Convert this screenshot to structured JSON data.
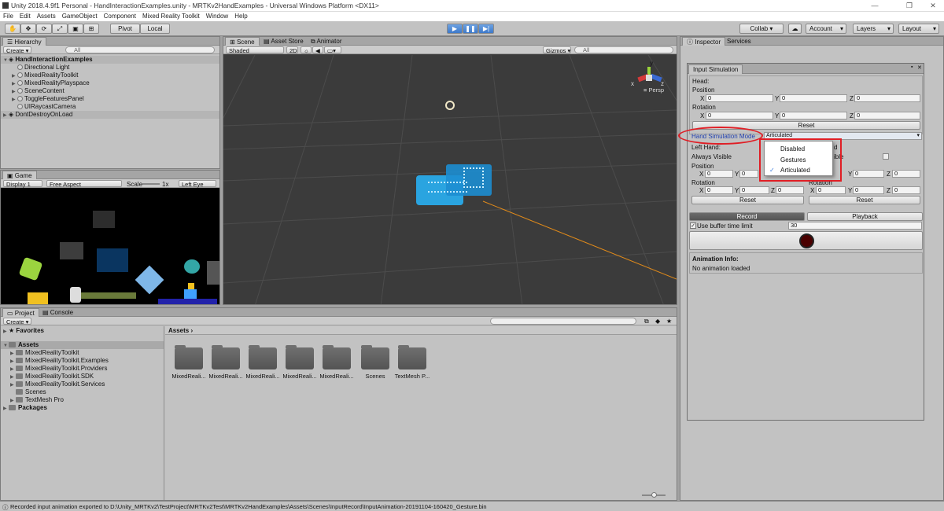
{
  "titlebar": {
    "title": "Unity 2018.4.9f1 Personal - HandInteractionExamples.unity - MRTKv2HandExamples - Universal Windows Platform <DX11>",
    "min": "—",
    "max": "❐",
    "close": "✕"
  },
  "menu": [
    "File",
    "Edit",
    "Assets",
    "GameObject",
    "Component",
    "Mixed Reality Toolkit",
    "Window",
    "Help"
  ],
  "toolbar": {
    "pivot": "Pivot",
    "local": "Local",
    "collab": "Collab ▾",
    "account": "Account",
    "layers": "Layers",
    "layout": "Layout"
  },
  "hierarchy": {
    "tab": "Hierarchy",
    "create": "Create",
    "search_placeholder": "All",
    "scene": "HandInteractionExamples",
    "items": [
      "Directional Light",
      "MixedRealityToolkit",
      "MixedRealityPlayspace",
      "SceneContent",
      "ToggleFeaturesPanel",
      "UIRaycastCamera"
    ],
    "dont_destroy": "DontDestroyOnLoad"
  },
  "game": {
    "tab": "Game",
    "display": "Display 1",
    "aspect": "Free Aspect",
    "scale_label": "Scale",
    "scale_value": "1x",
    "eye": "Left Eye"
  },
  "scene": {
    "tabs": [
      "Scene",
      "Asset Store",
      "Animator"
    ],
    "shaded": "Shaded",
    "mode2d": "2D",
    "gizmos": "Gizmos",
    "search_placeholder": "All",
    "persp": "Persp",
    "gizmo_x": "x",
    "gizmo_y": "y",
    "gizmo_z": "z"
  },
  "project": {
    "tabs": [
      "Project",
      "Console"
    ],
    "create": "Create",
    "favorites": "Favorites",
    "assets": "Assets",
    "tree": [
      "MixedRealityToolkit",
      "MixedRealityToolkit.Examples",
      "MixedRealityToolkit.Providers",
      "MixedRealityToolkit.SDK",
      "MixedRealityToolkit.Services",
      "Scenes",
      "TextMesh Pro"
    ],
    "packages": "Packages",
    "breadcrumb": "Assets",
    "breadcrumb_arrow": "›",
    "folders": [
      "MixedReali...",
      "MixedReali...",
      "MixedReali...",
      "MixedReali...",
      "MixedReali...",
      "Scenes",
      "TextMesh P..."
    ]
  },
  "inspector": {
    "tabs": [
      "Inspector",
      "Services"
    ],
    "window_title": "Input Simulation",
    "head": "Head:",
    "position": "Position",
    "rotation": "Rotation",
    "x": "X",
    "y": "Y",
    "z": "Z",
    "zero": "0",
    "reset": "Reset",
    "hand_mode_label": "Hand Simulation Mode",
    "hand_mode_value": "Articulated",
    "left_hand": "Left Hand:",
    "right_hand_fragment": "d",
    "always_visible": "Always Visible",
    "always_visible_fragment": "ible",
    "dropdown": [
      {
        "label": "Disabled",
        "checked": false
      },
      {
        "label": "Gestures",
        "checked": false
      },
      {
        "label": "Articulated",
        "checked": true
      }
    ],
    "record": "Record",
    "playback": "Playback",
    "use_buffer": "Use buffer time limit",
    "buffer_value": "30",
    "animation_info": "Animation Info:",
    "no_animation": "No animation loaded"
  },
  "statusbar": {
    "message": "Recorded input animation exported to D:\\Unity_MRTKv2\\TestProject\\MRTKv2Test\\MRTKv2HandExamples\\Assets\\Scenes\\InputRecord\\InputAnimation-20191104-160420_Gesture.bin"
  },
  "colors": {
    "accent_blue": "#3d78c9",
    "annotation_red": "#e01e25",
    "scene_bg": "#3b3b3b"
  }
}
